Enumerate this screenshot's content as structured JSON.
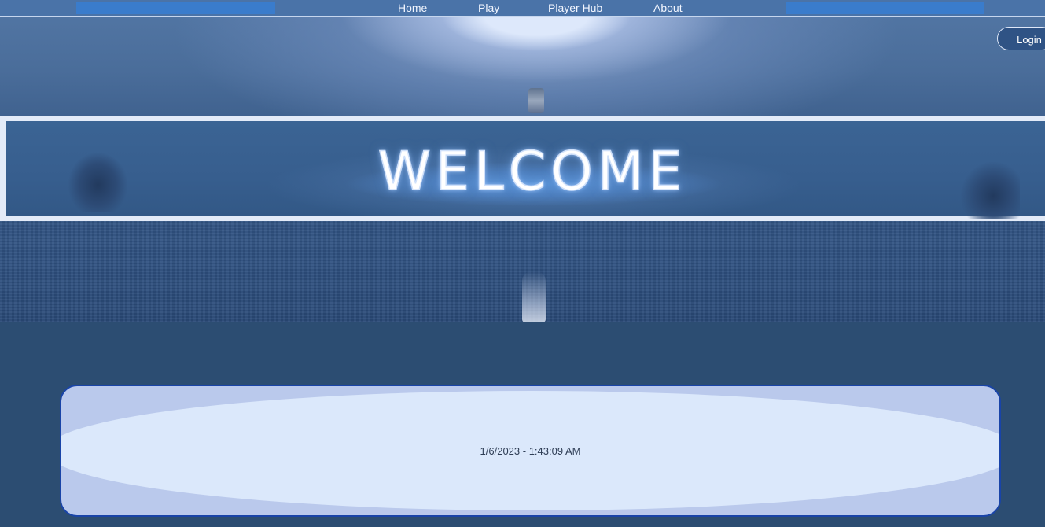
{
  "nav": {
    "items": [
      {
        "label": "Home"
      },
      {
        "label": "Play"
      },
      {
        "label": "Player Hub"
      },
      {
        "label": "About"
      }
    ]
  },
  "header": {
    "login_label": "Login"
  },
  "banner": {
    "title": "WELCOME"
  },
  "status_card": {
    "datetime": "1/6/2023 - 1:43:09 AM"
  },
  "colors": {
    "nav_accent": "#3a7ccc",
    "card_border": "#1944a8",
    "page_background": "#2c4d72"
  }
}
